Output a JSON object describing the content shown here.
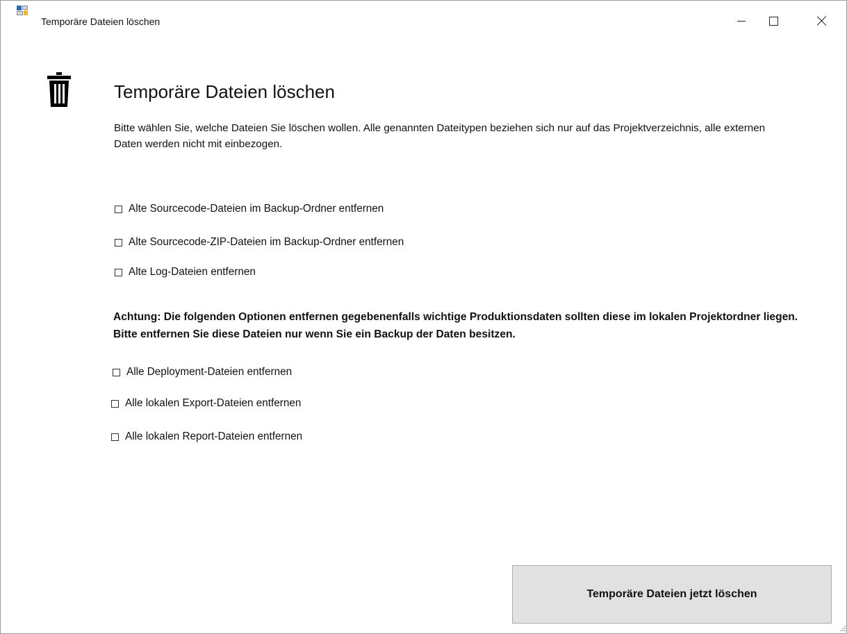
{
  "window": {
    "title": "Temporäre Dateien löschen",
    "controls": {
      "minimize": "minimize-icon",
      "maximize": "maximize-icon",
      "close": "close-icon"
    }
  },
  "header": {
    "icon": "trash-icon",
    "title": "Temporäre Dateien löschen",
    "description": "Bitte wählen Sie, welche Dateien Sie löschen wollen. Alle genannten Dateitypen beziehen sich nur auf das Projektverzeichnis, alle externen Daten werden nicht mit einbezogen."
  },
  "options_basic": [
    {
      "label": "Alte Sourcecode-Dateien im Backup-Ordner entfernen",
      "checked": false
    },
    {
      "label": "Alte Sourcecode-ZIP-Dateien im Backup-Ordner entfernen",
      "checked": false
    },
    {
      "label": "Alte Log-Dateien entfernen",
      "checked": false
    }
  ],
  "warning": "Achtung: Die folgenden Optionen entfernen gegebenenfalls wichtige Produktionsdaten sollten diese im lokalen Projektordner liegen. Bitte entfernen Sie diese Dateien nur wenn Sie ein Backup der Daten besitzen.",
  "options_advanced": [
    {
      "label": "Alle Deployment-Dateien entfernen",
      "checked": false
    },
    {
      "label": "Alle lokalen Export-Dateien entfernen",
      "checked": false
    },
    {
      "label": "Alle lokalen Report-Dateien entfernen",
      "checked": false
    }
  ],
  "actions": {
    "delete_now_label": "Temporäre Dateien jetzt löschen"
  }
}
